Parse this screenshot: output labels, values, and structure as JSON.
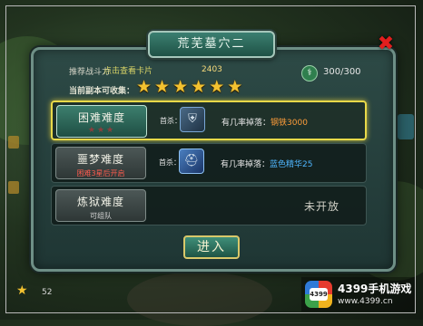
{
  "dialog": {
    "title": "荒芜墓穴二",
    "close_icon": "close-icon",
    "recommended_label": "推荐战斗力",
    "recommended_value": "2403",
    "overlay_text": "点击查看卡片",
    "stamina_icon": "stamina-icon",
    "stamina": "300/300",
    "stars_label": "当前副本可收集：",
    "star_count": 6
  },
  "difficulties": [
    {
      "name": "困难难度",
      "sub": "★★★",
      "selected": true,
      "first_label": "首杀：",
      "item_icon": "shield-item-icon",
      "drop_prefix": "有几率掉落：",
      "drop_item": "钢铁3000",
      "drop_color": "orange"
    },
    {
      "name": "噩梦难度",
      "sub": "困难3星后开启",
      "selected": false,
      "first_label": "首杀：",
      "item_icon": "helmet-item-icon",
      "drop_prefix": "有几率掉落：",
      "drop_item": "蓝色精华25",
      "drop_color": "blue"
    },
    {
      "name": "炼狱难度",
      "sub": "可组队",
      "selected": false,
      "status": "未开放"
    }
  ],
  "enter_button": "进入",
  "hud": {
    "star_icon": "star-icon",
    "count": "52"
  },
  "watermark": {
    "badge": "4399",
    "name": "4399手机游戏",
    "url": "www.4399.cn"
  },
  "colors": {
    "accent_gold": "#e8d949",
    "panel_teal": "#2d4a46",
    "drop_orange": "#ff9d3a",
    "drop_blue": "#4fb6ff"
  }
}
